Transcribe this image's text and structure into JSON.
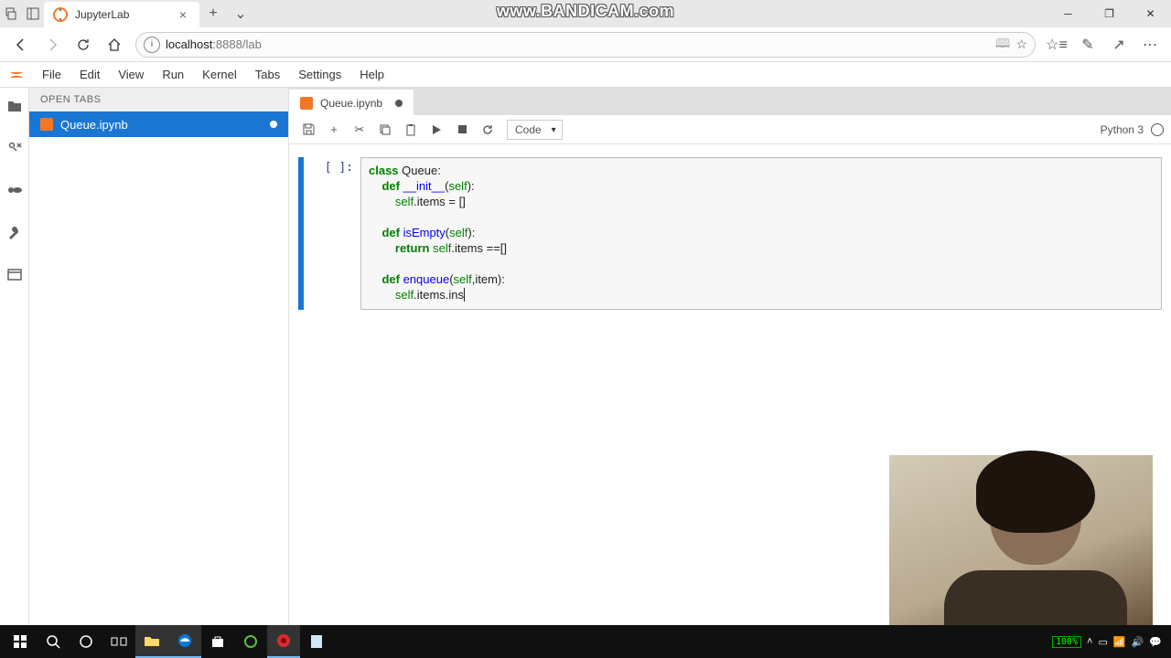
{
  "browser": {
    "tab_title": "JupyterLab",
    "url_prefix": "localhost",
    "url_suffix": ":8888/lab"
  },
  "watermark": "www.BANDICAM.com",
  "jlab_menu": [
    "File",
    "Edit",
    "View",
    "Run",
    "Kernel",
    "Tabs",
    "Settings",
    "Help"
  ],
  "left_panel": {
    "header": "OPEN TABS",
    "file": "Queue.ipynb"
  },
  "notebook": {
    "tab_label": "Queue.ipynb",
    "cell_type": "Code",
    "kernel": "Python 3",
    "prompt": "[ ]:"
  },
  "code": {
    "l1a": "class",
    "l1b": " Queue:",
    "l2a": "    def",
    "l2b": " __init__",
    "l2c": "(",
    "l2d": "self",
    "l2e": "):",
    "l3a": "        ",
    "l3b": "self",
    "l3c": ".items = []",
    "l4": "",
    "l5a": "    def",
    "l5b": " isEmpty",
    "l5c": "(",
    "l5d": "self",
    "l5e": "):",
    "l6a": "        return",
    "l6b": " ",
    "l6c": "self",
    "l6d": ".items ==[]",
    "l7": "",
    "l8a": "    def",
    "l8b": " enqueue",
    "l8c": "(",
    "l8d": "self",
    "l8e": ",item):",
    "l9a": "        ",
    "l9b": "self",
    "l9c": ".items.ins"
  },
  "taskbar": {
    "battery_label": "100%"
  }
}
